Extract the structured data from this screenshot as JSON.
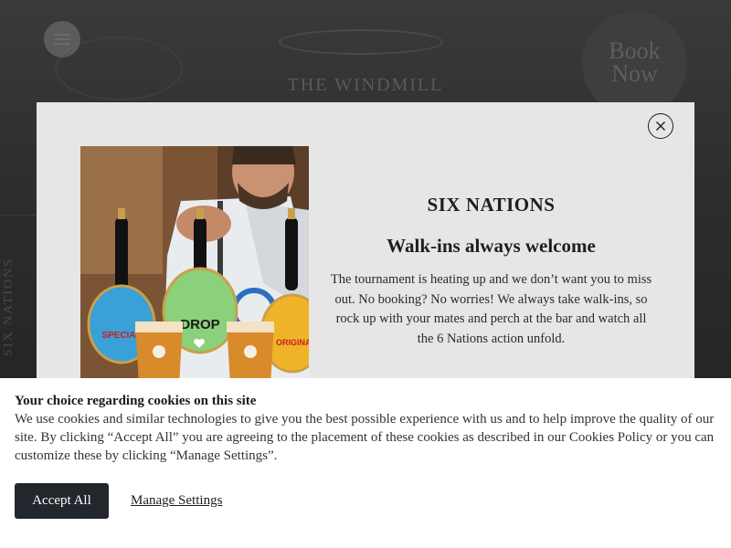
{
  "background": {
    "logo_text": "THE WINDMILL",
    "book_now_line1": "Book",
    "book_now_line2": "Now",
    "side_label": "SIX NATIONS",
    "menu_icon": "hamburger-icon"
  },
  "modal": {
    "close_icon": "close-icon",
    "image_alt": "bartender-pulling-pints-photo",
    "title": "SIX NATIONS",
    "subtitle": "Walk-ins always welcome",
    "body": "The tournament is heating up and we don’t want you to miss out. No booking? No worries! We always take walk-ins, so rock up with your mates and perch at the bar and watch all the 6 Nations action unfold.",
    "pump_labels": [
      "YOUNG'S SPECIAL",
      "DROP",
      "YOUNG'S ORIGINAL"
    ]
  },
  "cookie_banner": {
    "title": "Your choice regarding cookies on this site",
    "body": "We use cookies and similar technologies to give you the best possible experience with us and to help improve the quality of our site. By clicking “Accept All” you are agreeing to the placement of these cookies as described in our Cookies Policy or you can customize these by clicking “Manage Settings”.",
    "accept_label": "Accept All",
    "manage_label": "Manage Settings"
  },
  "colors": {
    "modal_bg": "#e6e6e6",
    "accept_button_bg": "#22272d",
    "banner_bg": "#ffffff"
  }
}
